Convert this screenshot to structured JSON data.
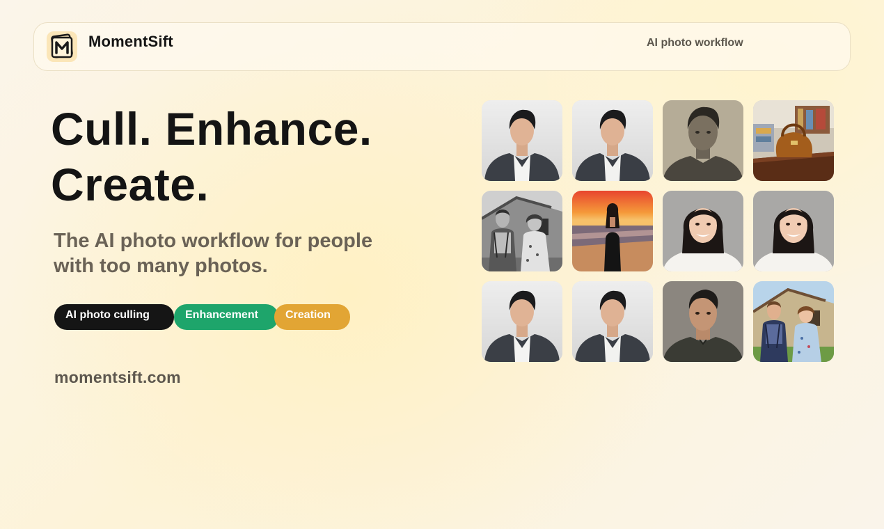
{
  "header": {
    "brand": "MomentSift",
    "logo_icon": "m-logo-icon",
    "nav_link": "AI photo workflow"
  },
  "hero": {
    "title_line1": "Cull. Enhance.",
    "title_line2": "Create.",
    "subtitle": "The AI photo workflow for people with too many photos."
  },
  "pills": [
    {
      "label": "AI photo culling",
      "color": "#151515"
    },
    {
      "label": "Enhancement",
      "color": "#1ea56b"
    },
    {
      "label": "Creation",
      "color": "#e2a534"
    }
  ],
  "site_url": "momentsift.com",
  "photos": [
    {
      "subject": "young man portrait, dark jacket",
      "style": "color"
    },
    {
      "subject": "young man portrait, dark jacket",
      "style": "color"
    },
    {
      "subject": "vintage man portrait",
      "style": "sepia"
    },
    {
      "subject": "leather handbag on wooden table",
      "style": "color"
    },
    {
      "subject": "vintage couple in front of house",
      "style": "bw"
    },
    {
      "subject": "woman on beach at sunset",
      "style": "color"
    },
    {
      "subject": "smiling young woman portrait",
      "style": "color"
    },
    {
      "subject": "smiling young woman portrait",
      "style": "color"
    },
    {
      "subject": "young man portrait, dark jacket",
      "style": "color"
    },
    {
      "subject": "young man portrait, dark jacket",
      "style": "color"
    },
    {
      "subject": "man portrait, gray background",
      "style": "color"
    },
    {
      "subject": "colorized couple in front of house",
      "style": "color"
    }
  ]
}
